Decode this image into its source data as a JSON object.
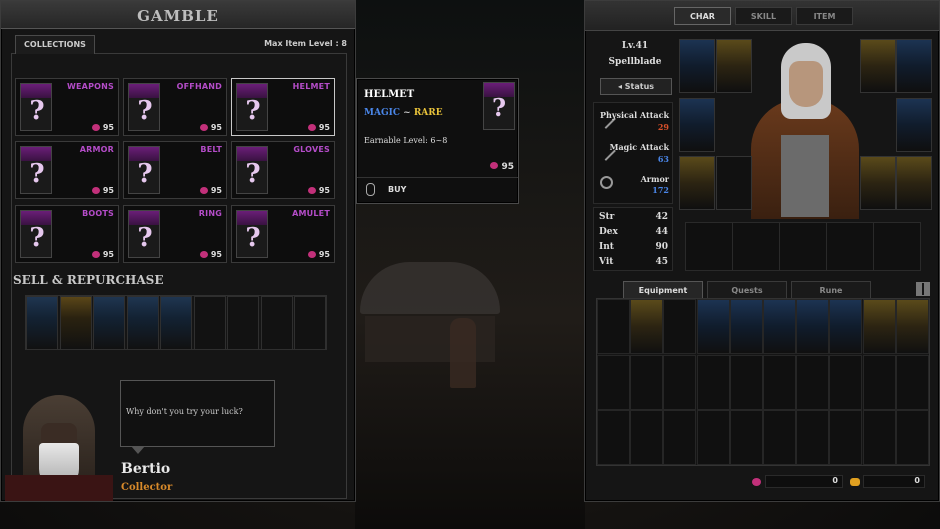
{
  "gamble": {
    "title": "GAMBLE",
    "collections_tab": "COLLECTIONS",
    "max_level": "Max Item Level : 8"
  },
  "categories": [
    {
      "name": "WEAPONS",
      "price": "95"
    },
    {
      "name": "OFFHAND",
      "price": "95"
    },
    {
      "name": "HELMET",
      "price": "95"
    },
    {
      "name": "ARMOR",
      "price": "95"
    },
    {
      "name": "BELT",
      "price": "95"
    },
    {
      "name": "GLOVES",
      "price": "95"
    },
    {
      "name": "BOOTS",
      "price": "95"
    },
    {
      "name": "RING",
      "price": "95"
    },
    {
      "name": "AMULET",
      "price": "95"
    }
  ],
  "sell": {
    "title": "SELL & REPURCHASE"
  },
  "npc": {
    "dialog": "Why don't you try your luck?",
    "name": "Bertio",
    "role": "Collector"
  },
  "tooltip": {
    "title": "HELMET",
    "rarity_magic": "MAGIC",
    "rarity_sep": " ~ ",
    "rarity_rare": "RARE",
    "level": "Earnable Level: 6~8",
    "price": "95",
    "buy": "BUY"
  },
  "char": {
    "tabs": [
      "CHAR",
      "SKILL",
      "ITEM"
    ],
    "level": "Lv.41",
    "class": "Spellblade",
    "status_btn": "Status",
    "physical_label": "Physical Attack",
    "physical_val": "29",
    "magic_label": "Magic Attack",
    "magic_val": "63",
    "armor_label": "Armor",
    "armor_val": "172",
    "stats": [
      {
        "k": "Str",
        "v": "42"
      },
      {
        "k": "Dex",
        "v": "44"
      },
      {
        "k": "Int",
        "v": "90"
      },
      {
        "k": "Vit",
        "v": "45"
      }
    ]
  },
  "inventory": {
    "tabs": [
      "Equipment",
      "Quests",
      "Rune"
    ],
    "gems": "0",
    "gold": "0"
  },
  "colors": {
    "magic": "#4a86e8",
    "rare": "#e8c23a",
    "gem": "#c2307a",
    "purple": "#b44cc8",
    "accent": "#d86a2a"
  }
}
